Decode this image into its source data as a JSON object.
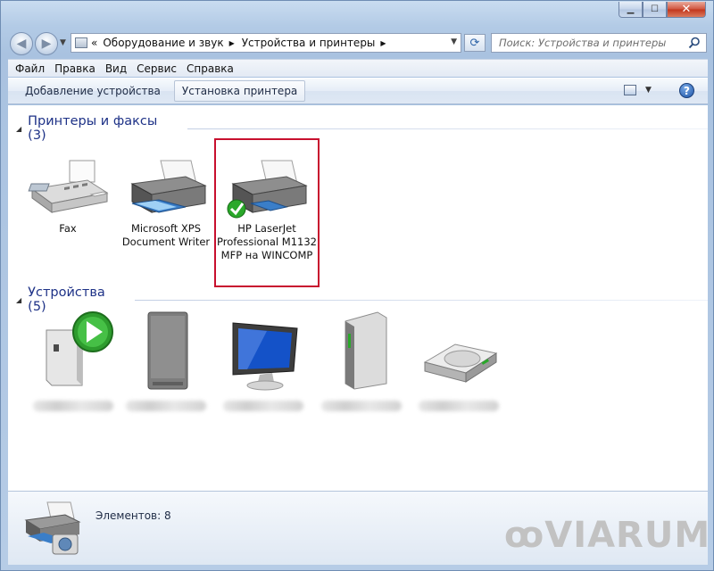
{
  "window": {
    "caption_buttons": [
      "minimize",
      "maximize",
      "close"
    ]
  },
  "address_bar": {
    "overflow": "«",
    "crumbs": [
      "Оборудование и звук",
      "Устройства и принтеры"
    ]
  },
  "search": {
    "placeholder": "Поиск: Устройства и принтеры"
  },
  "menu": {
    "items": [
      {
        "label": "Файл"
      },
      {
        "label": "Правка"
      },
      {
        "label": "Вид"
      },
      {
        "label": "Сервис"
      },
      {
        "label": "Справка"
      }
    ]
  },
  "commands": {
    "add_device": "Добавление устройства",
    "add_printer": "Установка принтера"
  },
  "groups": {
    "printers": {
      "title": "Принтеры и факсы (3)",
      "items": [
        {
          "label": "Fax",
          "icon": "fax-icon"
        },
        {
          "label": "Microsoft XPS Document Writer",
          "icon": "printer-icon"
        },
        {
          "label": "HP LaserJet Professional M1132 MFP на WINCOMP",
          "icon": "default-printer-icon",
          "selected": true
        }
      ]
    },
    "devices": {
      "title": "Устройства (5)",
      "items": [
        {
          "icon": "media-server-icon"
        },
        {
          "icon": "phone-icon"
        },
        {
          "icon": "monitor-icon"
        },
        {
          "icon": "external-drive-icon"
        },
        {
          "icon": "hard-drive-icon"
        }
      ]
    }
  },
  "status": {
    "text": "Элементов: 8"
  },
  "watermark": "VIARUM",
  "colors": {
    "group_title": "#1e3287",
    "selection_border": "#c8102e",
    "default_check": "#2aa82a"
  }
}
